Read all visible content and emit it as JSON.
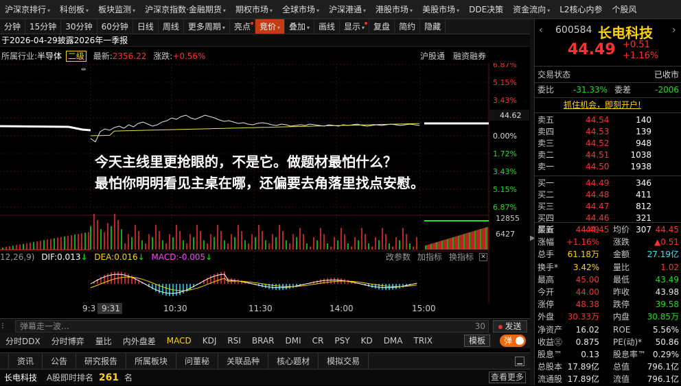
{
  "topnav": [
    {
      "label": "沪深京排行",
      "arrow": true
    },
    {
      "label": "科创板",
      "arrow": true
    },
    {
      "label": "板块监测",
      "arrow": true
    },
    {
      "label": "沪深京指数·金融期货",
      "arrow": true
    },
    {
      "label": "期权市场",
      "arrow": true
    },
    {
      "label": "全球市场",
      "arrow": true
    },
    {
      "label": "沪深港通",
      "arrow": true
    },
    {
      "label": "港股市场",
      "arrow": true
    },
    {
      "label": "美股市场",
      "arrow": true
    },
    {
      "label": "DDE决策",
      "arrow": false
    },
    {
      "label": "资金流向",
      "arrow": true
    },
    {
      "label": "L2核心内参",
      "arrow": false
    },
    {
      "label": "个股风",
      "arrow": false
    }
  ],
  "toolbar": [
    {
      "label": "分钟",
      "active": false
    },
    {
      "label": "15分钟",
      "active": false
    },
    {
      "label": "30分钟",
      "active": false
    },
    {
      "label": "60分钟",
      "active": false
    },
    {
      "label": "日线",
      "active": false
    },
    {
      "label": "周线",
      "active": false
    },
    {
      "label": "更多周期",
      "active": false,
      "arrow": true
    },
    {
      "label": "亮点",
      "active": false,
      "dot": true
    },
    {
      "label": "竞价",
      "active": true,
      "arrow": true
    },
    {
      "label": "叠加",
      "active": false,
      "arrow": true
    },
    {
      "label": "画线",
      "active": false
    },
    {
      "label": "显示",
      "active": false,
      "dot": true,
      "arrow": true
    },
    {
      "label": "复盘",
      "active": false
    },
    {
      "label": "简约",
      "active": false
    },
    {
      "label": "隐藏",
      "active": false
    }
  ],
  "notice": "于2026-04-29披露2026年一季报",
  "industry": {
    "prefix": "所属行业:",
    "name": "半导体",
    "level": "二级",
    "latest_label": "最新:",
    "latest": "2356.22",
    "chg_label": "涨跌:",
    "chg": "+0.56%",
    "link1": "沪股通",
    "link2": "融资融券"
  },
  "overlay": {
    "line1": "今天主线里更抢眼的，不是它。做题材最怕什么？",
    "line2": "最怕你明明看见主桌在哪，还偏要去角落里找点安慰。"
  },
  "price_axis": [
    "6.87%",
    "5.15%",
    "3.43%",
    "1.72%",
    "0.00%",
    "1.72%",
    "3.43%",
    "5.15%",
    "6.87%"
  ],
  "price_tag": "44.62",
  "vol_axis": [
    "12855",
    "6427"
  ],
  "macd": {
    "params": "12,26,9)",
    "dif": "DIF:0.013",
    "dif_arrow": "↓",
    "dea": "DEA:0.016",
    "dea_arrow": "↓",
    "macd": "MACD:-0.005",
    "macd_arrow": "↓",
    "btn1": "改参数",
    "btn2": "加指标",
    "btn3": "换指标"
  },
  "time_axis": [
    "9:3",
    "9:31",
    "10:30",
    "11:30",
    "14:00",
    "15:00"
  ],
  "chat": {
    "placeholder": "弹幕走一波…",
    "count": "30",
    "send": "发送"
  },
  "indicators": [
    {
      "label": "分时DDX",
      "sel": false
    },
    {
      "label": "分时博弈",
      "sel": false
    },
    {
      "label": "量比",
      "sel": false
    },
    {
      "label": "内外盘差",
      "sel": false
    },
    {
      "label": "MACD",
      "sel": true
    },
    {
      "label": "KDJ",
      "sel": false
    },
    {
      "label": "RSI",
      "sel": false
    },
    {
      "label": "BRAR",
      "sel": false
    },
    {
      "label": "DMI",
      "sel": false
    },
    {
      "label": "CR",
      "sel": false
    },
    {
      "label": "PSY",
      "sel": false
    },
    {
      "label": "KD",
      "sel": false
    },
    {
      "label": "DMA",
      "sel": false
    },
    {
      "label": "TRIX",
      "sel": false
    }
  ],
  "template_btn": "模板",
  "danmu_btn": "弹",
  "info_tabs": [
    "资讯",
    "公告",
    "研究报告",
    "所属板块",
    "问董秘",
    "关联品种",
    "核心题材",
    "模拟交易"
  ],
  "rank": {
    "name": "长电科技",
    "label": "A股即时排名",
    "num": "261",
    "unit": "名",
    "more": "查看更多"
  },
  "stock": {
    "code": "600584",
    "name": "长电科技",
    "price": "44.49",
    "chg": "+0.51",
    "pct": "+1.16%"
  },
  "status": {
    "label": "交易状态",
    "value": "已收市"
  },
  "weibi": {
    "label": "委比",
    "value": "-31.33%",
    "label2": "委差",
    "value2": "-2006"
  },
  "promo": "抓住机会，即刻开户!",
  "asks": [
    {
      "label": "卖五",
      "price": "44.54",
      "vol": "140"
    },
    {
      "label": "卖四",
      "price": "44.53",
      "vol": "139"
    },
    {
      "label": "卖三",
      "price": "44.52",
      "vol": "948"
    },
    {
      "label": "卖二",
      "price": "44.51",
      "vol": "1038"
    },
    {
      "label": "卖一",
      "price": "44.50",
      "vol": "1938"
    }
  ],
  "bids": [
    {
      "label": "买一",
      "price": "44.49",
      "vol": "346"
    },
    {
      "label": "买二",
      "price": "44.48",
      "vol": "411"
    },
    {
      "label": "买三",
      "price": "44.47",
      "vol": "812"
    },
    {
      "label": "买四",
      "price": "44.46",
      "vol": "321"
    },
    {
      "label": "买五",
      "price": "44.45",
      "vol": "307"
    }
  ],
  "quote": [
    {
      "l1": "最新",
      "v1": "44.49",
      "c1": "red",
      "l2": "均价",
      "v2": "44.45",
      "c2": "red"
    },
    {
      "l1": "涨幅",
      "v1": "+1.16%",
      "c1": "red",
      "l2": "涨跌",
      "v2": "▲0.51",
      "c2": "red"
    },
    {
      "l1": "总手",
      "v1": "61.18万",
      "c1": "yellow",
      "l2": "金额",
      "v2": "27.19亿",
      "c2": "cyan"
    },
    {
      "l1": "换手*",
      "v1": "3.42%",
      "c1": "yellow",
      "l2": "量比",
      "v2": "1.02",
      "c2": "red"
    },
    {
      "l1": "最高",
      "v1": "45.00",
      "c1": "red",
      "l2": "最低",
      "v2": "43.49",
      "c2": "green"
    },
    {
      "l1": "今开",
      "v1": "44.00",
      "c1": "red",
      "l2": "昨收",
      "v2": "43.98",
      "c2": "white"
    },
    {
      "l1": "涨停",
      "v1": "48.38",
      "c1": "red",
      "l2": "跌停",
      "v2": "39.58",
      "c2": "green"
    },
    {
      "l1": "外盘",
      "v1": "30.33万",
      "c1": "red",
      "l2": "内盘",
      "v2": "30.85万",
      "c2": "green"
    },
    {
      "l1": "净资产",
      "v1": "16.02",
      "c1": "white",
      "l2": "ROE",
      "v2": "5.56%",
      "c2": "white"
    },
    {
      "l1": "收益㊂",
      "v1": "0.875",
      "c1": "white",
      "l2": "PE(动)*",
      "v2": "50.86",
      "c2": "white"
    },
    {
      "l1": "股息™",
      "v1": "0.13",
      "c1": "white",
      "l2": "股息率™",
      "v2": "0.29%",
      "c2": "white"
    },
    {
      "l1": "总股本",
      "v1": "17.89亿",
      "c1": "white",
      "l2": "总值",
      "v2": "796.1亿",
      "c2": "white"
    },
    {
      "l1": "流通股",
      "v1": "17.89亿",
      "c1": "white",
      "l2": "流值",
      "v2": "796.1亿",
      "c2": "white"
    }
  ],
  "colors": {
    "up": "#ff3030",
    "down": "#16e716",
    "accent": "#c43a12",
    "avg_line": "#e8e84a",
    "price_line": "#ffffff"
  }
}
